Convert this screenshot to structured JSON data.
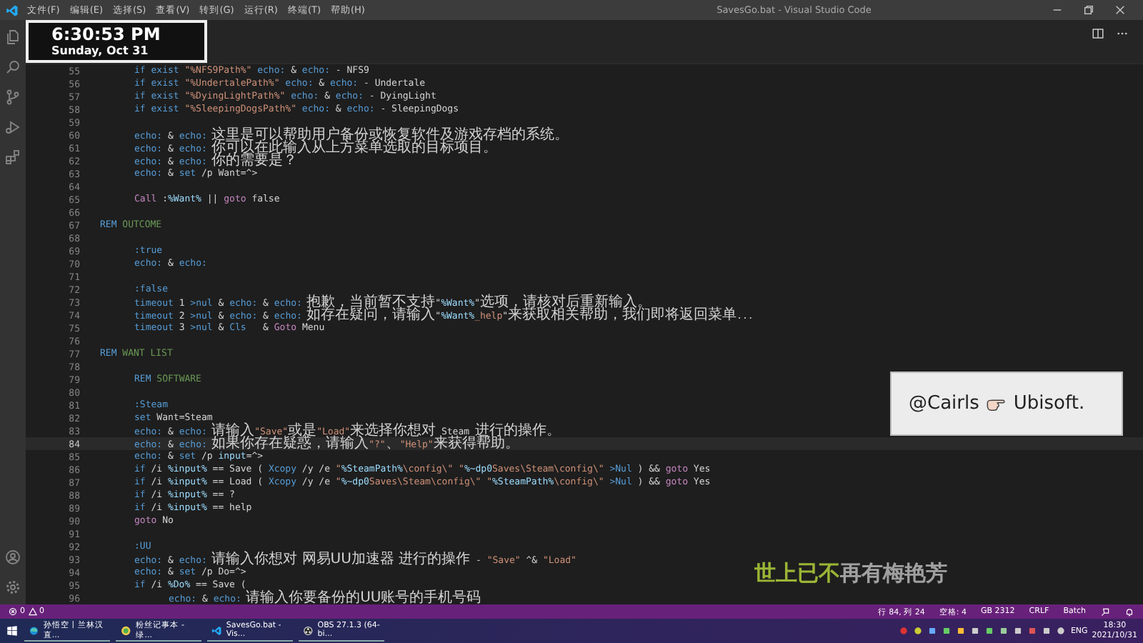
{
  "title_bar": {
    "menu": [
      "文件(F)",
      "编辑(E)",
      "选择(S)",
      "查看(V)",
      "转到(G)",
      "运行(R)",
      "终端(T)",
      "帮助(H)"
    ],
    "title": "SavesGo.bat - Visual Studio Code"
  },
  "editor": {
    "lines": [
      {
        "number": "55",
        "current": false,
        "kind": "block",
        "code": [
          {
            "kind": "keyword",
            "text": "if exist"
          },
          {
            "kind": "string",
            "text": " \"%NFS9Path%\""
          },
          {
            "kind": "keyword",
            "text": " echo:"
          },
          {
            "kind": "plain",
            "text": " & "
          },
          {
            "kind": "keyword",
            "text": "echo:"
          },
          {
            "kind": "plain",
            "text": " - NFS9"
          }
        ]
      },
      {
        "number": "56",
        "current": false,
        "kind": "block",
        "code": [
          {
            "kind": "keyword",
            "text": "if exist"
          },
          {
            "kind": "string",
            "text": " \"%UndertalePath%\""
          },
          {
            "kind": "keyword",
            "text": " echo:"
          },
          {
            "kind": "plain",
            "text": " & "
          },
          {
            "kind": "keyword",
            "text": "echo:"
          },
          {
            "kind": "plain",
            "text": " - Undertale"
          }
        ]
      },
      {
        "number": "57",
        "current": false,
        "kind": "block",
        "code": [
          {
            "kind": "keyword",
            "text": "if exist"
          },
          {
            "kind": "string",
            "text": " \"%DyingLightPath%\""
          },
          {
            "kind": "keyword",
            "text": " echo:"
          },
          {
            "kind": "plain",
            "text": " & "
          },
          {
            "kind": "keyword",
            "text": "echo:"
          },
          {
            "kind": "plain",
            "text": " - DyingLight"
          }
        ]
      },
      {
        "number": "58",
        "current": false,
        "kind": "block",
        "code": [
          {
            "kind": "keyword",
            "text": "if exist"
          },
          {
            "kind": "string",
            "text": " \"%SleepingDogsPath%\""
          },
          {
            "kind": "keyword",
            "text": " echo:"
          },
          {
            "kind": "plain",
            "text": " & "
          },
          {
            "kind": "keyword",
            "text": "echo:"
          },
          {
            "kind": "plain",
            "text": " - SleepingDogs"
          }
        ]
      },
      {
        "number": "59",
        "current": false
      },
      {
        "number": "60",
        "current": false,
        "kind": "block",
        "code": [
          {
            "kind": "keyword",
            "text": "echo:"
          },
          {
            "kind": "plain",
            "text": " & "
          },
          {
            "kind": "keyword",
            "text": "echo:"
          },
          {
            "kind": "zh",
            "text": " 这里是可以帮助用户备份或恢复软件及游戏存档的系统。"
          }
        ]
      },
      {
        "number": "61",
        "current": false,
        "kind": "block",
        "code": [
          {
            "kind": "keyword",
            "text": "echo:"
          },
          {
            "kind": "plain",
            "text": " & "
          },
          {
            "kind": "keyword",
            "text": "echo:"
          },
          {
            "kind": "zh",
            "text": " 你可以在此输入从上方菜单选取的目标项目。"
          }
        ]
      },
      {
        "number": "62",
        "current": false,
        "kind": "block",
        "code": [
          {
            "kind": "keyword",
            "text": "echo:"
          },
          {
            "kind": "plain",
            "text": " & "
          },
          {
            "kind": "keyword",
            "text": "echo:"
          },
          {
            "kind": "zh",
            "text": " 你的需要是？"
          }
        ]
      },
      {
        "number": "63",
        "current": false,
        "kind": "block",
        "code": [
          {
            "kind": "keyword",
            "text": "echo:"
          },
          {
            "kind": "plain",
            "text": " & "
          },
          {
            "kind": "keyword",
            "text": "set"
          },
          {
            "kind": "plain",
            "text": " /p Want=^>"
          }
        ]
      },
      {
        "number": "64",
        "current": false
      },
      {
        "number": "65",
        "current": false,
        "kind": "block",
        "code": [
          {
            "kind": "control",
            "text": "Call"
          },
          {
            "kind": "plain",
            "text": " :"
          },
          {
            "kind": "variable",
            "text": "%Want%"
          },
          {
            "kind": "plain",
            "text": " || "
          },
          {
            "kind": "control",
            "text": "goto"
          },
          {
            "kind": "plain",
            "text": " false"
          }
        ]
      },
      {
        "number": "66",
        "current": false
      },
      {
        "number": "67",
        "current": false,
        "kind": "top",
        "code": [
          {
            "kind": "keyword",
            "text": "REM"
          },
          {
            "kind": "comment",
            "text": " OUTCOME"
          }
        ]
      },
      {
        "number": "68",
        "current": false
      },
      {
        "number": "69",
        "current": false,
        "kind": "block",
        "code": [
          {
            "kind": "keyword",
            "text": ":true"
          }
        ]
      },
      {
        "number": "70",
        "current": false,
        "kind": "block",
        "code": [
          {
            "kind": "keyword",
            "text": "echo:"
          },
          {
            "kind": "plain",
            "text": " & "
          },
          {
            "kind": "keyword",
            "text": "echo:"
          }
        ]
      },
      {
        "number": "71",
        "current": false
      },
      {
        "number": "72",
        "current": false,
        "kind": "block",
        "code": [
          {
            "kind": "keyword",
            "text": ":false"
          }
        ]
      },
      {
        "number": "73",
        "current": false,
        "kind": "block",
        "code": [
          {
            "kind": "keyword",
            "text": "timeout"
          },
          {
            "kind": "plain",
            "text": " 1 "
          },
          {
            "kind": "keyword",
            "text": ">nul"
          },
          {
            "kind": "plain",
            "text": " & "
          },
          {
            "kind": "keyword",
            "text": "echo:"
          },
          {
            "kind": "plain",
            "text": " & "
          },
          {
            "kind": "keyword",
            "text": "echo:"
          },
          {
            "kind": "zh",
            "text": " 抱歉，当前暂不支持"
          },
          {
            "kind": "plain",
            "text": "\""
          },
          {
            "kind": "variable",
            "text": "%Want%"
          },
          {
            "kind": "plain",
            "text": "\""
          },
          {
            "kind": "zh",
            "text": "选项，请核对后重新输入。"
          }
        ]
      },
      {
        "number": "74",
        "current": false,
        "kind": "block",
        "code": [
          {
            "kind": "keyword",
            "text": "timeout"
          },
          {
            "kind": "plain",
            "text": " 2 "
          },
          {
            "kind": "keyword",
            "text": ">nul"
          },
          {
            "kind": "plain",
            "text": " & "
          },
          {
            "kind": "keyword",
            "text": "echo:"
          },
          {
            "kind": "plain",
            "text": " & "
          },
          {
            "kind": "keyword",
            "text": "echo:"
          },
          {
            "kind": "zh",
            "text": " 如存在疑问，请输入"
          },
          {
            "kind": "plain",
            "text": "\""
          },
          {
            "kind": "variable",
            "text": "%Want%"
          },
          {
            "kind": "string",
            "text": "_help"
          },
          {
            "kind": "plain",
            "text": "\""
          },
          {
            "kind": "zh",
            "text": "来获取相关帮助，我们即将返回菜单"
          },
          {
            "kind": "plain",
            "text": "..."
          }
        ]
      },
      {
        "number": "75",
        "current": false,
        "kind": "block",
        "code": [
          {
            "kind": "keyword",
            "text": "timeout"
          },
          {
            "kind": "plain",
            "text": " 3 "
          },
          {
            "kind": "keyword",
            "text": ">nul"
          },
          {
            "kind": "plain",
            "text": " & "
          },
          {
            "kind": "keyword",
            "text": "Cls"
          },
          {
            "kind": "plain",
            "text": "   & "
          },
          {
            "kind": "control",
            "text": "Goto"
          },
          {
            "kind": "plain",
            "text": " Menu"
          }
        ]
      },
      {
        "number": "76",
        "current": false
      },
      {
        "number": "77",
        "current": false,
        "kind": "top",
        "code": [
          {
            "kind": "keyword",
            "text": "REM"
          },
          {
            "kind": "comment",
            "text": " WANT LIST"
          }
        ]
      },
      {
        "number": "78",
        "current": false
      },
      {
        "number": "79",
        "current": false,
        "kind": "block",
        "code": [
          {
            "kind": "keyword",
            "text": "REM"
          },
          {
            "kind": "comment",
            "text": " SOFTWARE"
          }
        ]
      },
      {
        "number": "80",
        "current": false
      },
      {
        "number": "81",
        "current": false,
        "kind": "block",
        "code": [
          {
            "kind": "keyword",
            "text": ":Steam"
          }
        ]
      },
      {
        "number": "82",
        "current": false,
        "kind": "block",
        "code": [
          {
            "kind": "keyword",
            "text": "set"
          },
          {
            "kind": "plain",
            "text": " Want=Steam"
          }
        ]
      },
      {
        "number": "83",
        "current": false,
        "kind": "block",
        "code": [
          {
            "kind": "keyword",
            "text": "echo:"
          },
          {
            "kind": "plain",
            "text": " & "
          },
          {
            "kind": "keyword",
            "text": "echo:"
          },
          {
            "kind": "zh",
            "text": " 请输入"
          },
          {
            "kind": "string",
            "text": "\"Save\""
          },
          {
            "kind": "zh",
            "text": "或是"
          },
          {
            "kind": "string",
            "text": "\"Load\""
          },
          {
            "kind": "zh",
            "text": "来选择你想对"
          },
          {
            "kind": "plain",
            "text": " Steam "
          },
          {
            "kind": "zh",
            "text": "进行的操作。"
          }
        ]
      },
      {
        "number": "84",
        "current": true,
        "kind": "block",
        "code": [
          {
            "kind": "keyword",
            "text": "echo:"
          },
          {
            "kind": "plain",
            "text": " & "
          },
          {
            "kind": "keyword",
            "text": "echo:"
          },
          {
            "kind": "zh",
            "text": " 如果你存在疑惑，请输入"
          },
          {
            "kind": "string",
            "text": "\"?\""
          },
          {
            "kind": "zh",
            "text": "、"
          },
          {
            "kind": "string",
            "text": "\"Help\""
          },
          {
            "kind": "zh",
            "text": "来获得帮助。"
          }
        ]
      },
      {
        "number": "85",
        "current": false,
        "kind": "block",
        "code": [
          {
            "kind": "keyword",
            "text": "echo:"
          },
          {
            "kind": "plain",
            "text": " & "
          },
          {
            "kind": "keyword",
            "text": "set"
          },
          {
            "kind": "plain",
            "text": " /p "
          },
          {
            "kind": "variable",
            "text": "input"
          },
          {
            "kind": "plain",
            "text": "=^>"
          }
        ]
      },
      {
        "number": "86",
        "current": false,
        "kind": "block",
        "code": [
          {
            "kind": "keyword",
            "text": "if"
          },
          {
            "kind": "plain",
            "text": " /i "
          },
          {
            "kind": "variable",
            "text": "%input%"
          },
          {
            "kind": "plain",
            "text": " == Save ( "
          },
          {
            "kind": "keyword",
            "text": "Xcopy"
          },
          {
            "kind": "plain",
            "text": " /y /e "
          },
          {
            "kind": "string",
            "text": "\""
          },
          {
            "kind": "variable",
            "text": "%SteamPath%"
          },
          {
            "kind": "string",
            "text": "\\config\\\" \""
          },
          {
            "kind": "variable",
            "text": "%~dp0"
          },
          {
            "kind": "string",
            "text": "Saves\\Steam\\config\\\""
          },
          {
            "kind": "keyword",
            "text": " >Nul"
          },
          {
            "kind": "plain",
            "text": " ) && "
          },
          {
            "kind": "control",
            "text": "goto"
          },
          {
            "kind": "plain",
            "text": " Yes"
          }
        ]
      },
      {
        "number": "87",
        "current": false,
        "kind": "block",
        "code": [
          {
            "kind": "keyword",
            "text": "if"
          },
          {
            "kind": "plain",
            "text": " /i "
          },
          {
            "kind": "variable",
            "text": "%input%"
          },
          {
            "kind": "plain",
            "text": " == Load ( "
          },
          {
            "kind": "keyword",
            "text": "Xcopy"
          },
          {
            "kind": "plain",
            "text": " /y /e "
          },
          {
            "kind": "string",
            "text": "\""
          },
          {
            "kind": "variable",
            "text": "%~dp0"
          },
          {
            "kind": "string",
            "text": "Saves\\Steam\\config\\\" \""
          },
          {
            "kind": "variable",
            "text": "%SteamPath%"
          },
          {
            "kind": "string",
            "text": "\\config\\\""
          },
          {
            "kind": "keyword",
            "text": " >Nul"
          },
          {
            "kind": "plain",
            "text": " ) && "
          },
          {
            "kind": "control",
            "text": "goto"
          },
          {
            "kind": "plain",
            "text": " Yes"
          }
        ]
      },
      {
        "number": "88",
        "current": false,
        "kind": "block",
        "code": [
          {
            "kind": "keyword",
            "text": "if"
          },
          {
            "kind": "plain",
            "text": " /i "
          },
          {
            "kind": "variable",
            "text": "%input%"
          },
          {
            "kind": "plain",
            "text": " == ?"
          }
        ]
      },
      {
        "number": "89",
        "current": false,
        "kind": "block",
        "code": [
          {
            "kind": "keyword",
            "text": "if"
          },
          {
            "kind": "plain",
            "text": " /i "
          },
          {
            "kind": "variable",
            "text": "%input%"
          },
          {
            "kind": "plain",
            "text": " == help"
          }
        ]
      },
      {
        "number": "90",
        "current": false,
        "kind": "block",
        "code": [
          {
            "kind": "control",
            "text": "goto"
          },
          {
            "kind": "plain",
            "text": " No"
          }
        ]
      },
      {
        "number": "91",
        "current": false
      },
      {
        "number": "92",
        "current": false,
        "kind": "block",
        "code": [
          {
            "kind": "keyword",
            "text": ":UU"
          }
        ]
      },
      {
        "number": "93",
        "current": false,
        "kind": "block",
        "code": [
          {
            "kind": "keyword",
            "text": "echo:"
          },
          {
            "kind": "plain",
            "text": " & "
          },
          {
            "kind": "keyword",
            "text": "echo:"
          },
          {
            "kind": "zh",
            "text": " 请输入你想对 网易UU加速器 进行的操作"
          },
          {
            "kind": "plain",
            "text": " - "
          },
          {
            "kind": "string",
            "text": "\"Save\""
          },
          {
            "kind": "plain",
            "text": " ^& "
          },
          {
            "kind": "string",
            "text": "\"Load\""
          }
        ]
      },
      {
        "number": "94",
        "current": false,
        "kind": "block",
        "code": [
          {
            "kind": "keyword",
            "text": "echo:"
          },
          {
            "kind": "plain",
            "text": " & "
          },
          {
            "kind": "keyword",
            "text": "set"
          },
          {
            "kind": "plain",
            "text": " /p Do=^>"
          }
        ]
      },
      {
        "number": "95",
        "current": false,
        "kind": "block",
        "code": [
          {
            "kind": "keyword",
            "text": "if"
          },
          {
            "kind": "plain",
            "text": " /i "
          },
          {
            "kind": "variable",
            "text": "%Do%"
          },
          {
            "kind": "plain",
            "text": " == Save ("
          }
        ]
      },
      {
        "number": "96",
        "current": false,
        "kind": "inner",
        "code": [
          {
            "kind": "keyword",
            "text": "echo:"
          },
          {
            "kind": "plain",
            "text": " & "
          },
          {
            "kind": "keyword",
            "text": "echo:"
          },
          {
            "kind": "zh",
            "text": " 请输入你要备份的UU账号的手机号码"
          }
        ]
      }
    ]
  },
  "status_bar": {
    "errors": "0",
    "warnings": "0",
    "items": [
      "行 84, 列 24",
      "空格: 4",
      "GB 2312",
      "CRLF",
      "Batch"
    ]
  },
  "taskbar": {
    "apps": [
      "孙悟空丨兰林汉直...",
      "粉丝记事本 - 绿...",
      "SavesGo.bat - Vis...",
      "OBS 27.1.3 (64-bi..."
    ],
    "language": "ENG",
    "time": "18:30",
    "date": "2021/10/31"
  },
  "overlays": {
    "clock": {
      "time": "6:30:53 PM",
      "date": "Sunday, Oct 31"
    },
    "card": {
      "handle": "@Cairls",
      "target": "Ubisoft."
    },
    "subtitle": [
      {
        "text": "世上已不",
        "sung": true
      },
      {
        "text": "再有梅艳芳",
        "sung": false
      }
    ]
  }
}
